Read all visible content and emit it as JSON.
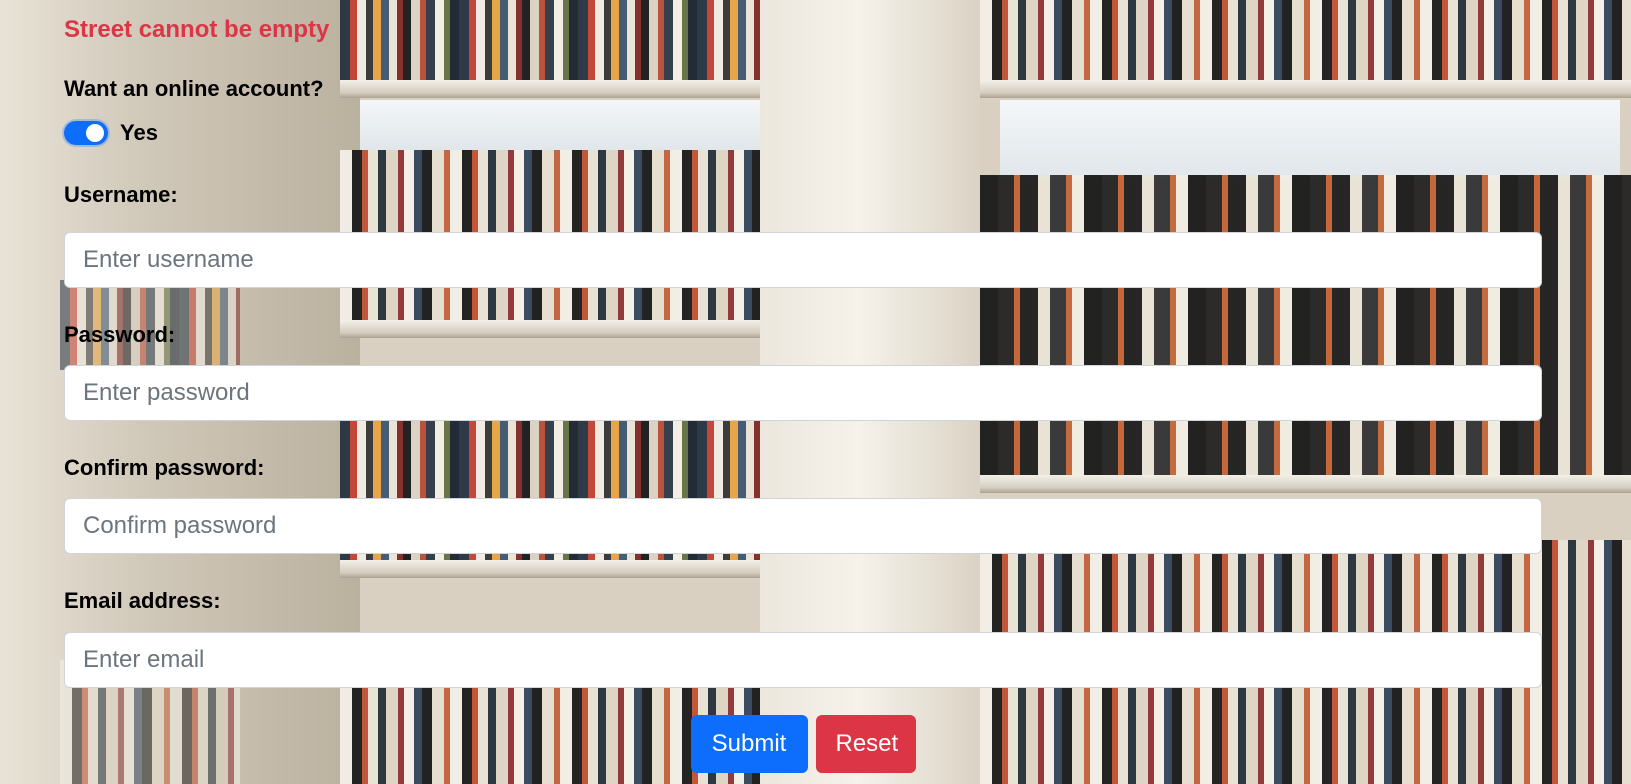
{
  "form": {
    "error_message": "Street cannot be empty",
    "online_account": {
      "question": "Want an online account?",
      "toggle_label": "Yes",
      "toggle_on": true
    },
    "username": {
      "label": "Username:",
      "placeholder": "Enter username",
      "value": ""
    },
    "password": {
      "label": "Password:",
      "placeholder": "Enter password",
      "value": ""
    },
    "confirm_password": {
      "label": "Confirm password:",
      "placeholder": "Confirm password",
      "value": ""
    },
    "email": {
      "label": "Email address:",
      "placeholder": "Enter email",
      "value": ""
    },
    "buttons": {
      "submit": "Submit",
      "reset": "Reset"
    }
  },
  "colors": {
    "error": "#dc3545",
    "primary": "#0d6efd",
    "danger": "#dc3545"
  }
}
